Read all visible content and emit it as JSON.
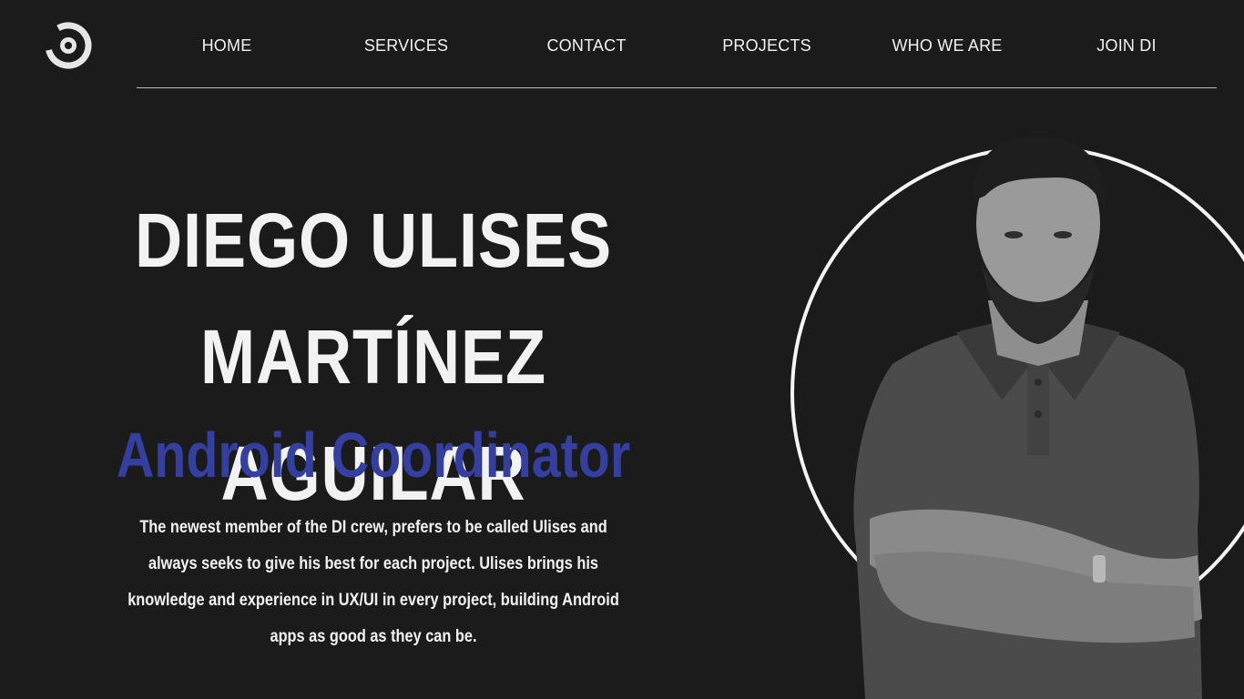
{
  "nav": {
    "items": [
      {
        "label": "HOME"
      },
      {
        "label": "SERVICES"
      },
      {
        "label": "CONTACT"
      },
      {
        "label": "PROJECTS"
      },
      {
        "label": "WHO WE ARE"
      },
      {
        "label": "JOIN DI"
      }
    ]
  },
  "profile": {
    "name_line1": "DIEGO ULISES MARTÍNEZ",
    "name_line2": "AGUILAR",
    "role": "Android Coordinator",
    "bio": "The newest member of the DI crew, prefers to be called Ulises and always seeks to give his best for each project. Ulises brings his knowledge and experience in UX/UI in every project, building Android apps as good as they can be."
  },
  "icons": {
    "logo": "di-logo-icon",
    "portrait": "person-portrait"
  },
  "colors": {
    "background": "#1b1b1c",
    "text": "#f2f2f2",
    "accent": "#343fa0",
    "divider": "#bdbdbd"
  }
}
